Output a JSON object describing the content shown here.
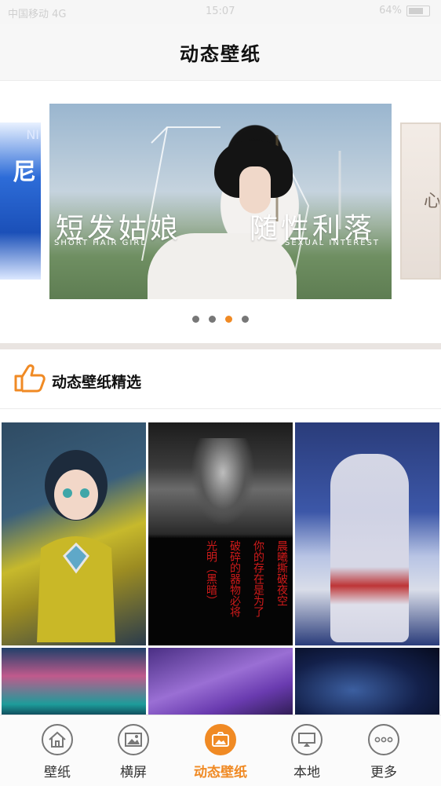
{
  "status_bar": {
    "carrier": "中国移动 4G",
    "time": "15:07",
    "battery": "64%"
  },
  "header": {
    "title": "动态壁纸"
  },
  "banner": {
    "left_peek_text": "尼",
    "left_peek_sub": "NI",
    "right_peek_text": "心",
    "headline_left": "短发姑娘",
    "headline_right": "随性利落",
    "sub_left": "SHORT HAIR GIRL",
    "sub_right": "SEXUAL INTEREST",
    "page_count": 4,
    "active_page": 3
  },
  "section": {
    "title": "动态壁纸精选",
    "icon": "thumbs-up-icon"
  },
  "grid": {
    "tile2_text": [
      "晨曦撕破夜空",
      "你的存在是为了",
      "破碎的器物必将",
      "光明（黑暗）"
    ]
  },
  "tabs": [
    {
      "label": "壁纸",
      "icon": "home-icon"
    },
    {
      "label": "横屏",
      "icon": "landscape-image-icon"
    },
    {
      "label": "动态壁纸",
      "icon": "live-wallpaper-icon"
    },
    {
      "label": "本地",
      "icon": "local-icon"
    },
    {
      "label": "更多",
      "icon": "more-icon"
    }
  ],
  "colors": {
    "accent": "#f08a24"
  }
}
